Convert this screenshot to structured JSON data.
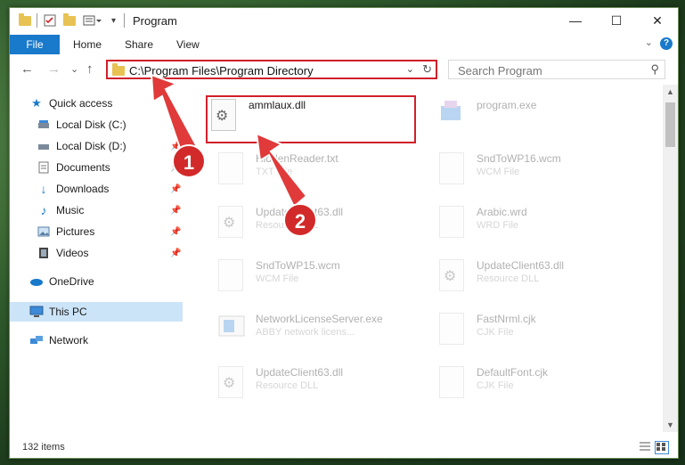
{
  "titlebar": {
    "title": "Program",
    "minimize": "—",
    "maximize": "☐",
    "close": "✕"
  },
  "ribbon": {
    "file": "File",
    "tabs": [
      "Home",
      "Share",
      "View"
    ],
    "help": "?",
    "chevron": "⌄"
  },
  "nav": {
    "back": "←",
    "forward": "→",
    "recent": "⌄",
    "up": "↑",
    "address": "C:\\Program Files\\Program Directory",
    "address_drop": "⌄",
    "refresh": "↻",
    "search_placeholder": "Search Program",
    "search_icon": "⚲"
  },
  "sidebar": {
    "quick_access": "Quick access",
    "items": [
      {
        "label": "Local Disk (C:)",
        "icon": "disk-icon"
      },
      {
        "label": "Local Disk (D:)",
        "icon": "disk-icon"
      },
      {
        "label": "Documents",
        "icon": "documents-icon"
      },
      {
        "label": "Downloads",
        "icon": "downloads-icon"
      },
      {
        "label": "Music",
        "icon": "music-icon"
      },
      {
        "label": "Pictures",
        "icon": "pictures-icon"
      },
      {
        "label": "Videos",
        "icon": "videos-icon"
      }
    ],
    "onedrive": "OneDrive",
    "this_pc": "This PC",
    "network": "Network"
  },
  "files": [
    {
      "name": "ammlaux.dll",
      "type": ""
    },
    {
      "name": "program.exe",
      "type": ""
    },
    {
      "name": "HiddenReader.txt",
      "type": "TXT File"
    },
    {
      "name": "SndToWP16.wcm",
      "type": "WCM File"
    },
    {
      "name": "UpdateClient63.dll",
      "type": "Resource DLL"
    },
    {
      "name": "Arabic.wrd",
      "type": "WRD File"
    },
    {
      "name": "SndToWP15.wcm",
      "type": "WCM File"
    },
    {
      "name": "UpdateClient63.dll",
      "type": "Resource DLL"
    },
    {
      "name": "NetworkLicenseServer.exe",
      "type": "ABBY network licens..."
    },
    {
      "name": "FastNrml.cjk",
      "type": "CJK File"
    },
    {
      "name": "UpdateClient63.dll",
      "type": "Resource DLL"
    },
    {
      "name": "DefaultFont.cjk",
      "type": "CJK File"
    }
  ],
  "status": {
    "items": "132 items"
  },
  "callouts": {
    "one": "1",
    "two": "2"
  },
  "colors": {
    "accent": "#1979ca",
    "highlight_red": "#d0202a",
    "selected": "#cce4f7"
  }
}
